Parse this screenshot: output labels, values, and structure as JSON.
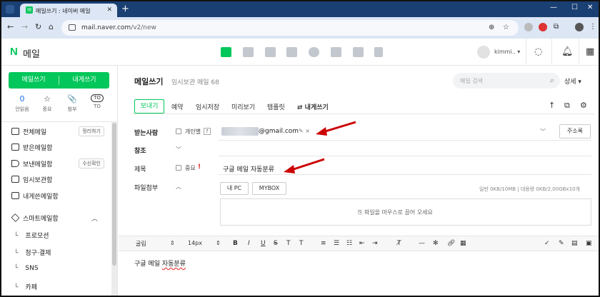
{
  "browser": {
    "tab_title": "메일쓰기 : 네이버 메일",
    "url_host": "mail.naver.com",
    "url_path": "/v2/new"
  },
  "header": {
    "logo_n": "N",
    "logo_text": "메일",
    "account_name": "kimmi..",
    "app_icons": [
      "mail-icon",
      "calendar-icon",
      "memo-icon",
      "contacts-icon",
      "mybox-icon",
      "todo-icon",
      "home-icon",
      "bookmark-icon"
    ]
  },
  "sidebar": {
    "write_mail": "메일쓰기",
    "write_to_me": "내게쓰기",
    "quick": [
      {
        "top": "0",
        "label": "안읽음"
      },
      {
        "top": "☆",
        "label": "중요"
      },
      {
        "top": "📎",
        "label": "첨부"
      },
      {
        "top": "TO",
        "label": "TO"
      }
    ],
    "items": [
      {
        "label": "전체메일",
        "badge": "정리하기"
      },
      {
        "label": "받은메일함",
        "badge": ""
      },
      {
        "label": "보낸메일함",
        "badge": "수신확인"
      },
      {
        "label": "임시보관함",
        "badge": ""
      },
      {
        "label": "내게쓴메일함",
        "badge": ""
      }
    ],
    "smart_label": "스마트메일함",
    "smart_sub": [
      "프로모션",
      "청구·결제",
      "SNS",
      "카페"
    ]
  },
  "main": {
    "title": "메일쓰기",
    "subtitle": "임시보관 메일 68",
    "search_placeholder": "메일 검색",
    "detail_label": "상세 ▾",
    "toolbar": {
      "send": "보내기",
      "reserve": "예약",
      "save_draft": "임시저장",
      "preview": "미리보기",
      "template": "템플릿",
      "write_self": "⇄ 내게쓰기"
    },
    "recipient_label": "받는사람",
    "individual_label": "개인별",
    "help": "?",
    "recipient_email": "@gmail.com",
    "address_book": "주소록",
    "cc_label": "참조",
    "subject_label": "제목",
    "important_label": "중요",
    "important_mark": "!",
    "subject_value": "구글 메일 자동분류",
    "attach_label": "파일첨부",
    "my_pc": "내 PC",
    "mybox": "MYBOX",
    "attach_info": "일반 0KB/10MB | 대용량 0KB/2,00GBx10개",
    "drop_text": "파일을 마우스로 끌어 오세요",
    "editor": {
      "font": "굴림",
      "size": "14px"
    },
    "body_text_plain": "구글 메일 ",
    "body_text_marked": "자동분류"
  },
  "colors": {
    "brand": "#03c75a",
    "tab_bar": "#1a3f73",
    "arrow": "#cc0000"
  }
}
